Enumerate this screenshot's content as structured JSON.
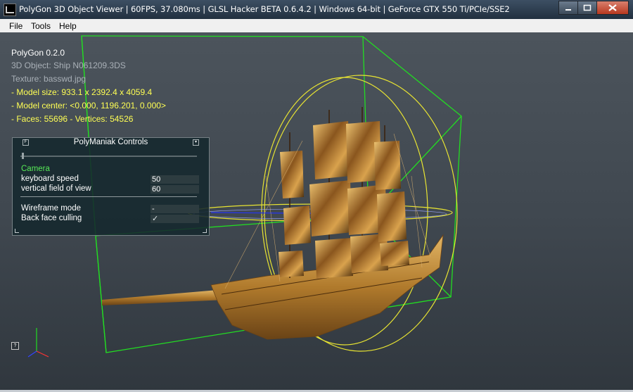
{
  "window": {
    "title": "PolyGon 3D Object Viewer | 60FPS, 37.080ms | GLSL Hacker BETA 0.6.4.2 | Windows 64-bit | GeForce GTX 550 Ti/PCIe/SSE2",
    "minimize_icon": "minimize-icon",
    "maximize_icon": "maximize-icon",
    "close_icon": "close-icon"
  },
  "menu": {
    "file": "File",
    "tools": "Tools",
    "help": "Help"
  },
  "overlay": {
    "app_name": "PolyGon 0.2.0",
    "object_line": "3D Object: Ship N061209.3DS",
    "texture_line": "Texture: basswd.jpg",
    "model_size": "- Model size:  933.1 x 2392.4 x 4059.4",
    "model_center": "- Model center:  <0.000, 1196.201, 0.000>",
    "faces_vertices": "- Faces: 55696 - Vertices: 54526"
  },
  "panel": {
    "title": "PolyManiak Controls",
    "section_camera": "Camera",
    "keyboard_speed_label": "keyboard speed",
    "keyboard_speed_value": "50",
    "fov_label": "vertical field of view",
    "fov_value": "60",
    "wireframe_label": "Wireframe mode",
    "wireframe_value": "-",
    "backface_label": "Back face culling",
    "backface_value": "✓"
  },
  "colors": {
    "overlay_yellow": "#ffff54",
    "camera_green": "#57e957",
    "bbox_green": "#22dd22",
    "sphere_yellow": "#e8e432",
    "ship_gold": "#c08a3a"
  }
}
